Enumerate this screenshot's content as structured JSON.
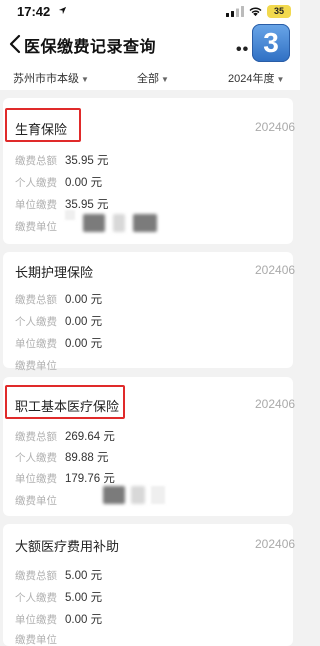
{
  "status_bar": {
    "time": "17:42",
    "battery": "35"
  },
  "nav": {
    "title": "医保缴费记录查询",
    "more": "••",
    "badge": "3"
  },
  "filters": {
    "region": "苏州市市本级",
    "category": "全部",
    "year": "2024年度"
  },
  "cards": [
    {
      "title": "生育保险",
      "date": "202406",
      "rows": [
        {
          "label": "缴费总额",
          "value": "35.95 元"
        },
        {
          "label": "个人缴费",
          "value": "0.00 元"
        },
        {
          "label": "单位缴费",
          "value": "35.95 元"
        },
        {
          "label": "缴费单位",
          "value": ""
        }
      ]
    },
    {
      "title": "长期护理保险",
      "date": "202406",
      "rows": [
        {
          "label": "缴费总额",
          "value": "0.00 元"
        },
        {
          "label": "个人缴费",
          "value": "0.00 元"
        },
        {
          "label": "单位缴费",
          "value": "0.00 元"
        },
        {
          "label": "缴费单位",
          "value": ""
        }
      ]
    },
    {
      "title": "职工基本医疗保险",
      "date": "202406",
      "rows": [
        {
          "label": "缴费总额",
          "value": "269.64 元"
        },
        {
          "label": "个人缴费",
          "value": "89.88 元"
        },
        {
          "label": "单位缴费",
          "value": "179.76 元"
        },
        {
          "label": "缴费单位",
          "value": ""
        }
      ]
    },
    {
      "title": "大额医疗费用补助",
      "date": "202406",
      "rows": [
        {
          "label": "缴费总额",
          "value": "5.00 元"
        },
        {
          "label": "个人缴费",
          "value": "5.00 元"
        },
        {
          "label": "单位缴费",
          "value": "0.00 元"
        },
        {
          "label": "缴费单位",
          "value": ""
        }
      ]
    }
  ],
  "colors": {
    "highlight": "#e02a2a",
    "badge": "#2f6fc3",
    "battery": "#f2d94e"
  }
}
